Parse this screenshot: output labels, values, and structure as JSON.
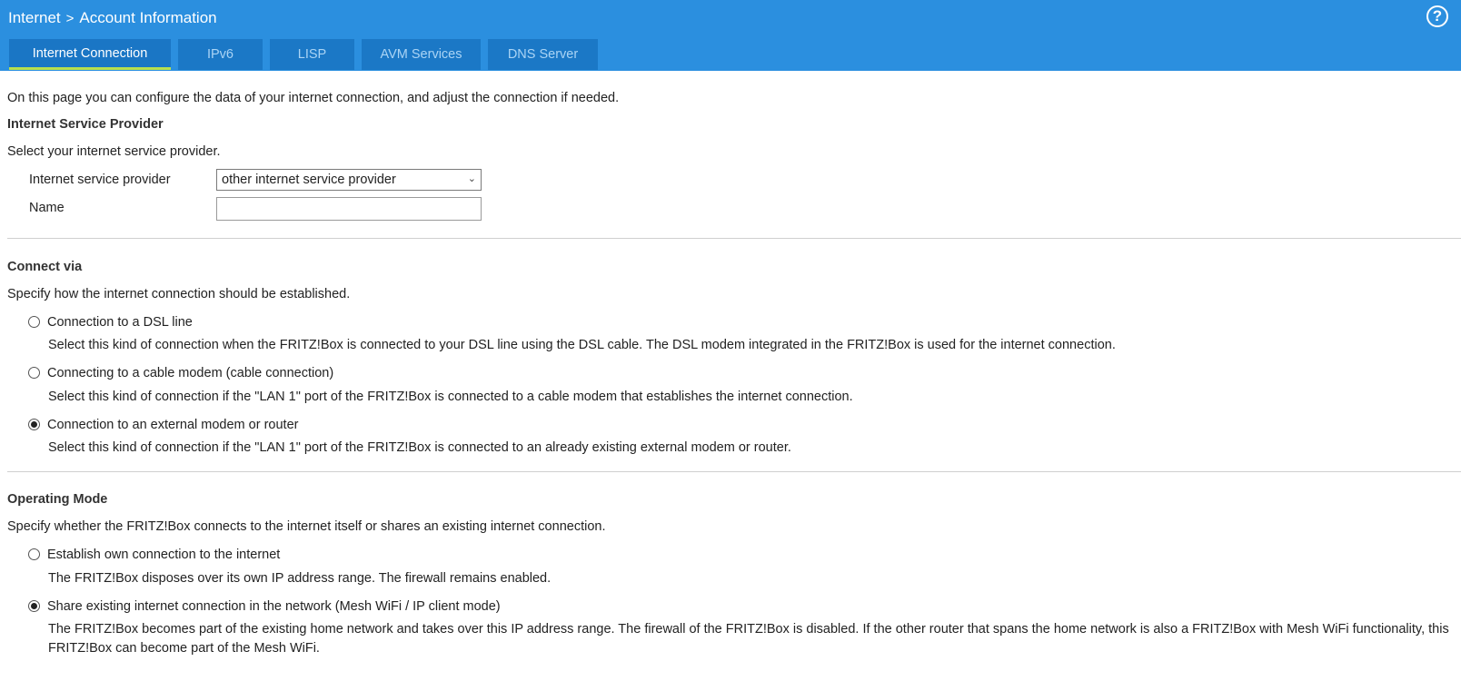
{
  "header": {
    "breadcrumb_root": "Internet",
    "breadcrumb_separator": ">",
    "breadcrumb_current": "Account Information",
    "help_symbol": "?",
    "accent_color": "#2b8fdf",
    "active_tab_underline": "#b8df4f"
  },
  "tabs": [
    {
      "label": "Internet Connection",
      "active": true
    },
    {
      "label": "IPv6",
      "active": false
    },
    {
      "label": "LISP",
      "active": false
    },
    {
      "label": "AVM Services",
      "active": false
    },
    {
      "label": "DNS Server",
      "active": false
    }
  ],
  "intro": "On this page you can configure the data of your internet connection, and adjust the connection if needed.",
  "isp": {
    "heading": "Internet Service Provider",
    "description": "Select your internet service provider.",
    "provider_label": "Internet service provider",
    "provider_value": "other internet service provider",
    "name_label": "Name",
    "name_value": ""
  },
  "connect_via": {
    "heading": "Connect via",
    "description": "Specify how the internet connection should be established.",
    "options": [
      {
        "label": "Connection to a DSL line",
        "desc": "Select this kind of connection when the FRITZ!Box is connected to your DSL line using the DSL cable. The DSL modem integrated in the FRITZ!Box is used for the internet connection.",
        "checked": false
      },
      {
        "label": "Connecting to a cable modem (cable connection)",
        "desc": "Select this kind of connection if the \"LAN 1\" port of the FRITZ!Box is connected to a cable modem that establishes the internet connection.",
        "checked": false
      },
      {
        "label": "Connection to an external modem or router",
        "desc": "Select this kind of connection if the \"LAN 1\" port of the FRITZ!Box is connected to an already existing external modem or router.",
        "checked": true
      }
    ]
  },
  "operating_mode": {
    "heading": "Operating Mode",
    "description": "Specify whether the FRITZ!Box connects to the internet itself or shares an existing internet connection.",
    "options": [
      {
        "label": "Establish own connection to the internet",
        "desc": "The FRITZ!Box disposes over its own IP address range. The firewall remains enabled.",
        "checked": false
      },
      {
        "label": "Share existing internet connection in the network (Mesh WiFi / IP client mode)",
        "desc": "The FRITZ!Box becomes part of the existing home network and takes over this IP address range. The firewall of the FRITZ!Box is disabled. If the other router that spans the home network is also a FRITZ!Box with Mesh WiFi functionality, this FRITZ!Box can become part of the Mesh WiFi.",
        "checked": true
      }
    ]
  }
}
